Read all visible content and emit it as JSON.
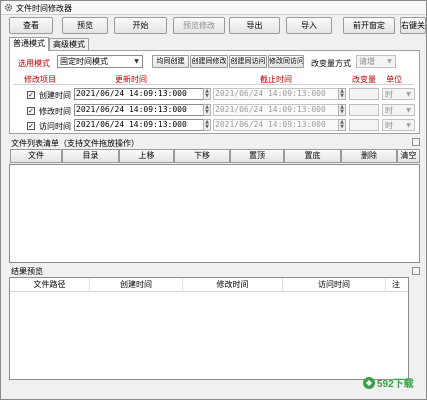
{
  "window": {
    "title": "文件时间修改器"
  },
  "toolbar": [
    {
      "label": "查看",
      "disabled": false
    },
    {
      "label": "预览",
      "disabled": false
    },
    {
      "label": "开始",
      "disabled": false
    },
    {
      "label": "预览修改",
      "disabled": true
    },
    {
      "label": "导出",
      "disabled": false
    },
    {
      "label": "导入",
      "disabled": false
    },
    {
      "label": "前开窗定",
      "disabled": false
    },
    {
      "label": "右键关",
      "disabled": false
    }
  ],
  "tabs": [
    {
      "label": "普通模式",
      "active": true
    },
    {
      "label": "高级模式",
      "active": false
    }
  ],
  "mode": {
    "label": "选用模式",
    "value": "固定时间模式",
    "buttons": [
      "均同创建",
      "创建同修改",
      "创建同访问",
      "修改同访问"
    ],
    "change_method_label": "改变量方式",
    "change_method_value": "请增"
  },
  "grid_headers": {
    "item": "修改项目",
    "change_time": "更新时间",
    "end_time": "截止时间",
    "change_amount": "改变量",
    "unit": "单位"
  },
  "rows": [
    {
      "label": "创建时间",
      "checked": true,
      "change_time": "2021/06/24 14:09:13:000",
      "end_time": "2021/06/24 14:09:13:000",
      "unit": "时"
    },
    {
      "label": "修改时间",
      "checked": true,
      "change_time": "2021/06/24 14:09:13:000",
      "end_time": "2021/06/24 14:09:13:000",
      "unit": "时"
    },
    {
      "label": "访问时间",
      "checked": true,
      "change_time": "2021/06/24 14:09:13:000",
      "end_time": "2021/06/24 14:09:13:000",
      "unit": "时"
    }
  ],
  "file_list": {
    "label": "文件列表清单（支持文件拖放操作）",
    "buttons": [
      "文件",
      "目录",
      "上移",
      "下移",
      "置顶",
      "置底",
      "删除",
      "清空"
    ]
  },
  "results": {
    "label": "结果预览",
    "columns": [
      "文件路径",
      "创建时间",
      "修改时间",
      "访问时间",
      "注"
    ]
  },
  "watermark": {
    "text": "592下载"
  },
  "icons": {
    "app": "gear-icon",
    "dropdown": "chevron-down-icon",
    "check": "checkmark-icon",
    "spin": "spin-arrows-icon"
  },
  "colors": {
    "accent_red": "#c00000",
    "watermark_green": "#3aa14a"
  }
}
